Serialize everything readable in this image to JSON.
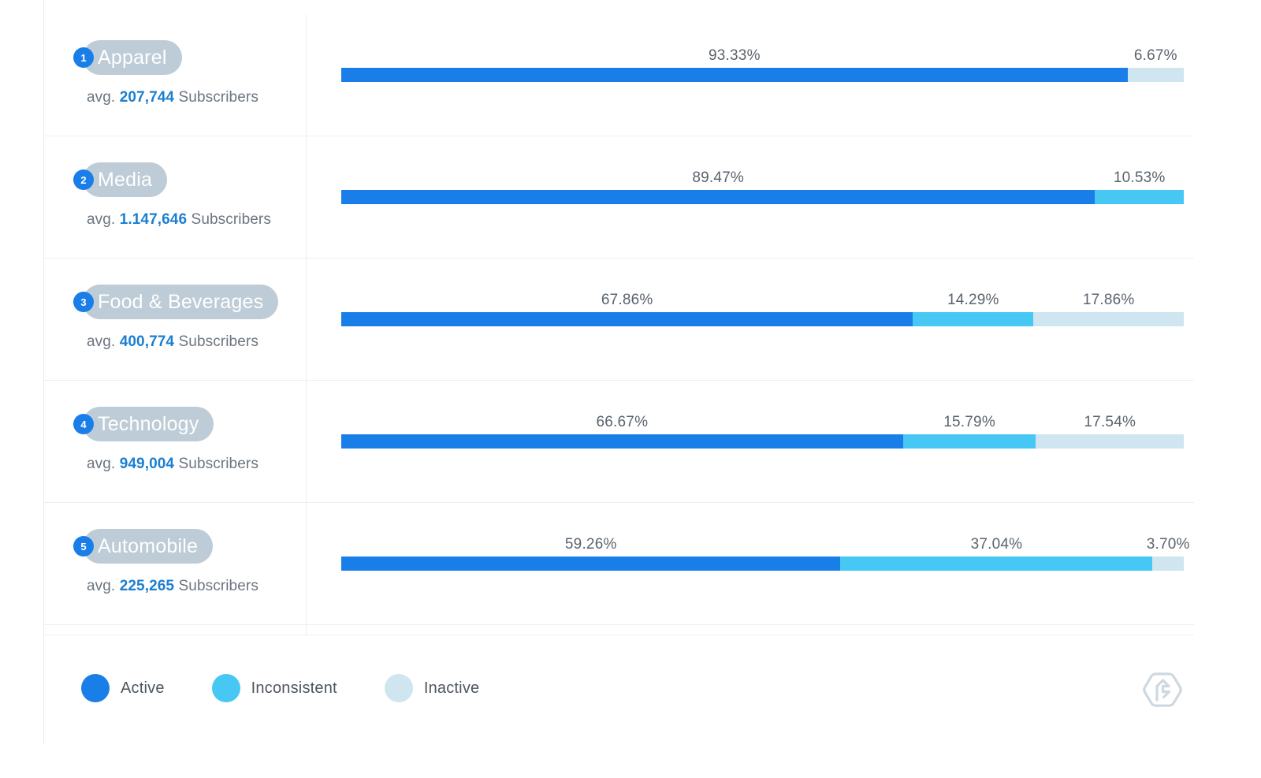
{
  "chart_data": {
    "type": "bar",
    "title": "",
    "subtitle": "",
    "xlabel": "",
    "ylabel": "",
    "orientation": "horizontal",
    "stacked": true,
    "grid": false,
    "legend_position": "bottom-left",
    "unit": "%",
    "axis_range": [
      0,
      100
    ],
    "categories": [
      "Apparel",
      "Media",
      "Food & Beverages",
      "Technology",
      "Automobile"
    ],
    "series": [
      {
        "name": "Active",
        "color": "#1a7ee8",
        "values": [
          93.33,
          89.47,
          67.86,
          66.67,
          59.26
        ]
      },
      {
        "name": "Inconsistent",
        "color": "#47c7f4",
        "values": [
          0,
          10.53,
          14.29,
          15.79,
          37.04
        ]
      },
      {
        "name": "Inactive",
        "color": "#cfe5ef",
        "values": [
          6.67,
          0,
          17.86,
          17.54,
          3.7
        ]
      }
    ],
    "rows": [
      {
        "rank": "1",
        "category": "Apparel",
        "avg_prefix": "avg.",
        "avg_value": "207,744",
        "avg_suffix": "Subscribers",
        "segments": [
          {
            "key": "active",
            "label": "93.33%",
            "value": 93.33
          },
          {
            "key": "inactive",
            "label": "6.67%",
            "value": 6.67
          }
        ]
      },
      {
        "rank": "2",
        "category": "Media",
        "avg_prefix": "avg.",
        "avg_value": "1.147,646",
        "avg_suffix": "Subscribers",
        "segments": [
          {
            "key": "active",
            "label": "89.47%",
            "value": 89.47
          },
          {
            "key": "inconsistent",
            "label": "10.53%",
            "value": 10.53
          }
        ]
      },
      {
        "rank": "3",
        "category": "Food & Beverages",
        "avg_prefix": "avg.",
        "avg_value": "400,774",
        "avg_suffix": "Subscribers",
        "segments": [
          {
            "key": "active",
            "label": "67.86%",
            "value": 67.86
          },
          {
            "key": "inconsistent",
            "label": "14.29%",
            "value": 14.29
          },
          {
            "key": "inactive",
            "label": "17.86%",
            "value": 17.86
          }
        ]
      },
      {
        "rank": "4",
        "category": "Technology",
        "avg_prefix": "avg.",
        "avg_value": "949,004",
        "avg_suffix": "Subscribers",
        "segments": [
          {
            "key": "active",
            "label": "66.67%",
            "value": 66.67
          },
          {
            "key": "inconsistent",
            "label": "15.79%",
            "value": 15.79
          },
          {
            "key": "inactive",
            "label": "17.54%",
            "value": 17.54
          }
        ]
      },
      {
        "rank": "5",
        "category": "Automobile",
        "avg_prefix": "avg.",
        "avg_value": "225,265",
        "avg_suffix": "Subscribers",
        "segments": [
          {
            "key": "active",
            "label": "59.26%",
            "value": 59.26
          },
          {
            "key": "inconsistent",
            "label": "37.04%",
            "value": 37.04
          },
          {
            "key": "inactive",
            "label": "3.70%",
            "value": 3.7
          }
        ]
      }
    ]
  },
  "legend": {
    "items": [
      {
        "label": "Active",
        "color": "#1a7ee8"
      },
      {
        "label": "Inconsistent",
        "color": "#47c7f4"
      },
      {
        "label": "Inactive",
        "color": "#cfe5ef"
      }
    ]
  },
  "branding": {
    "logo_name": "brand-logo-icon",
    "logo_color": "#c6d2da"
  },
  "colors": {
    "active": "#1a7ee8",
    "inconsistent": "#47c7f4",
    "inactive": "#cfe5ef",
    "pill_bg": "#bdccd6",
    "pill_text": "#ffffff",
    "badge_bg": "#1a7ee8",
    "number_accent": "#1b7fd1",
    "muted_text": "#6b7580",
    "divider": "#eceff2",
    "background": "#ffffff"
  }
}
